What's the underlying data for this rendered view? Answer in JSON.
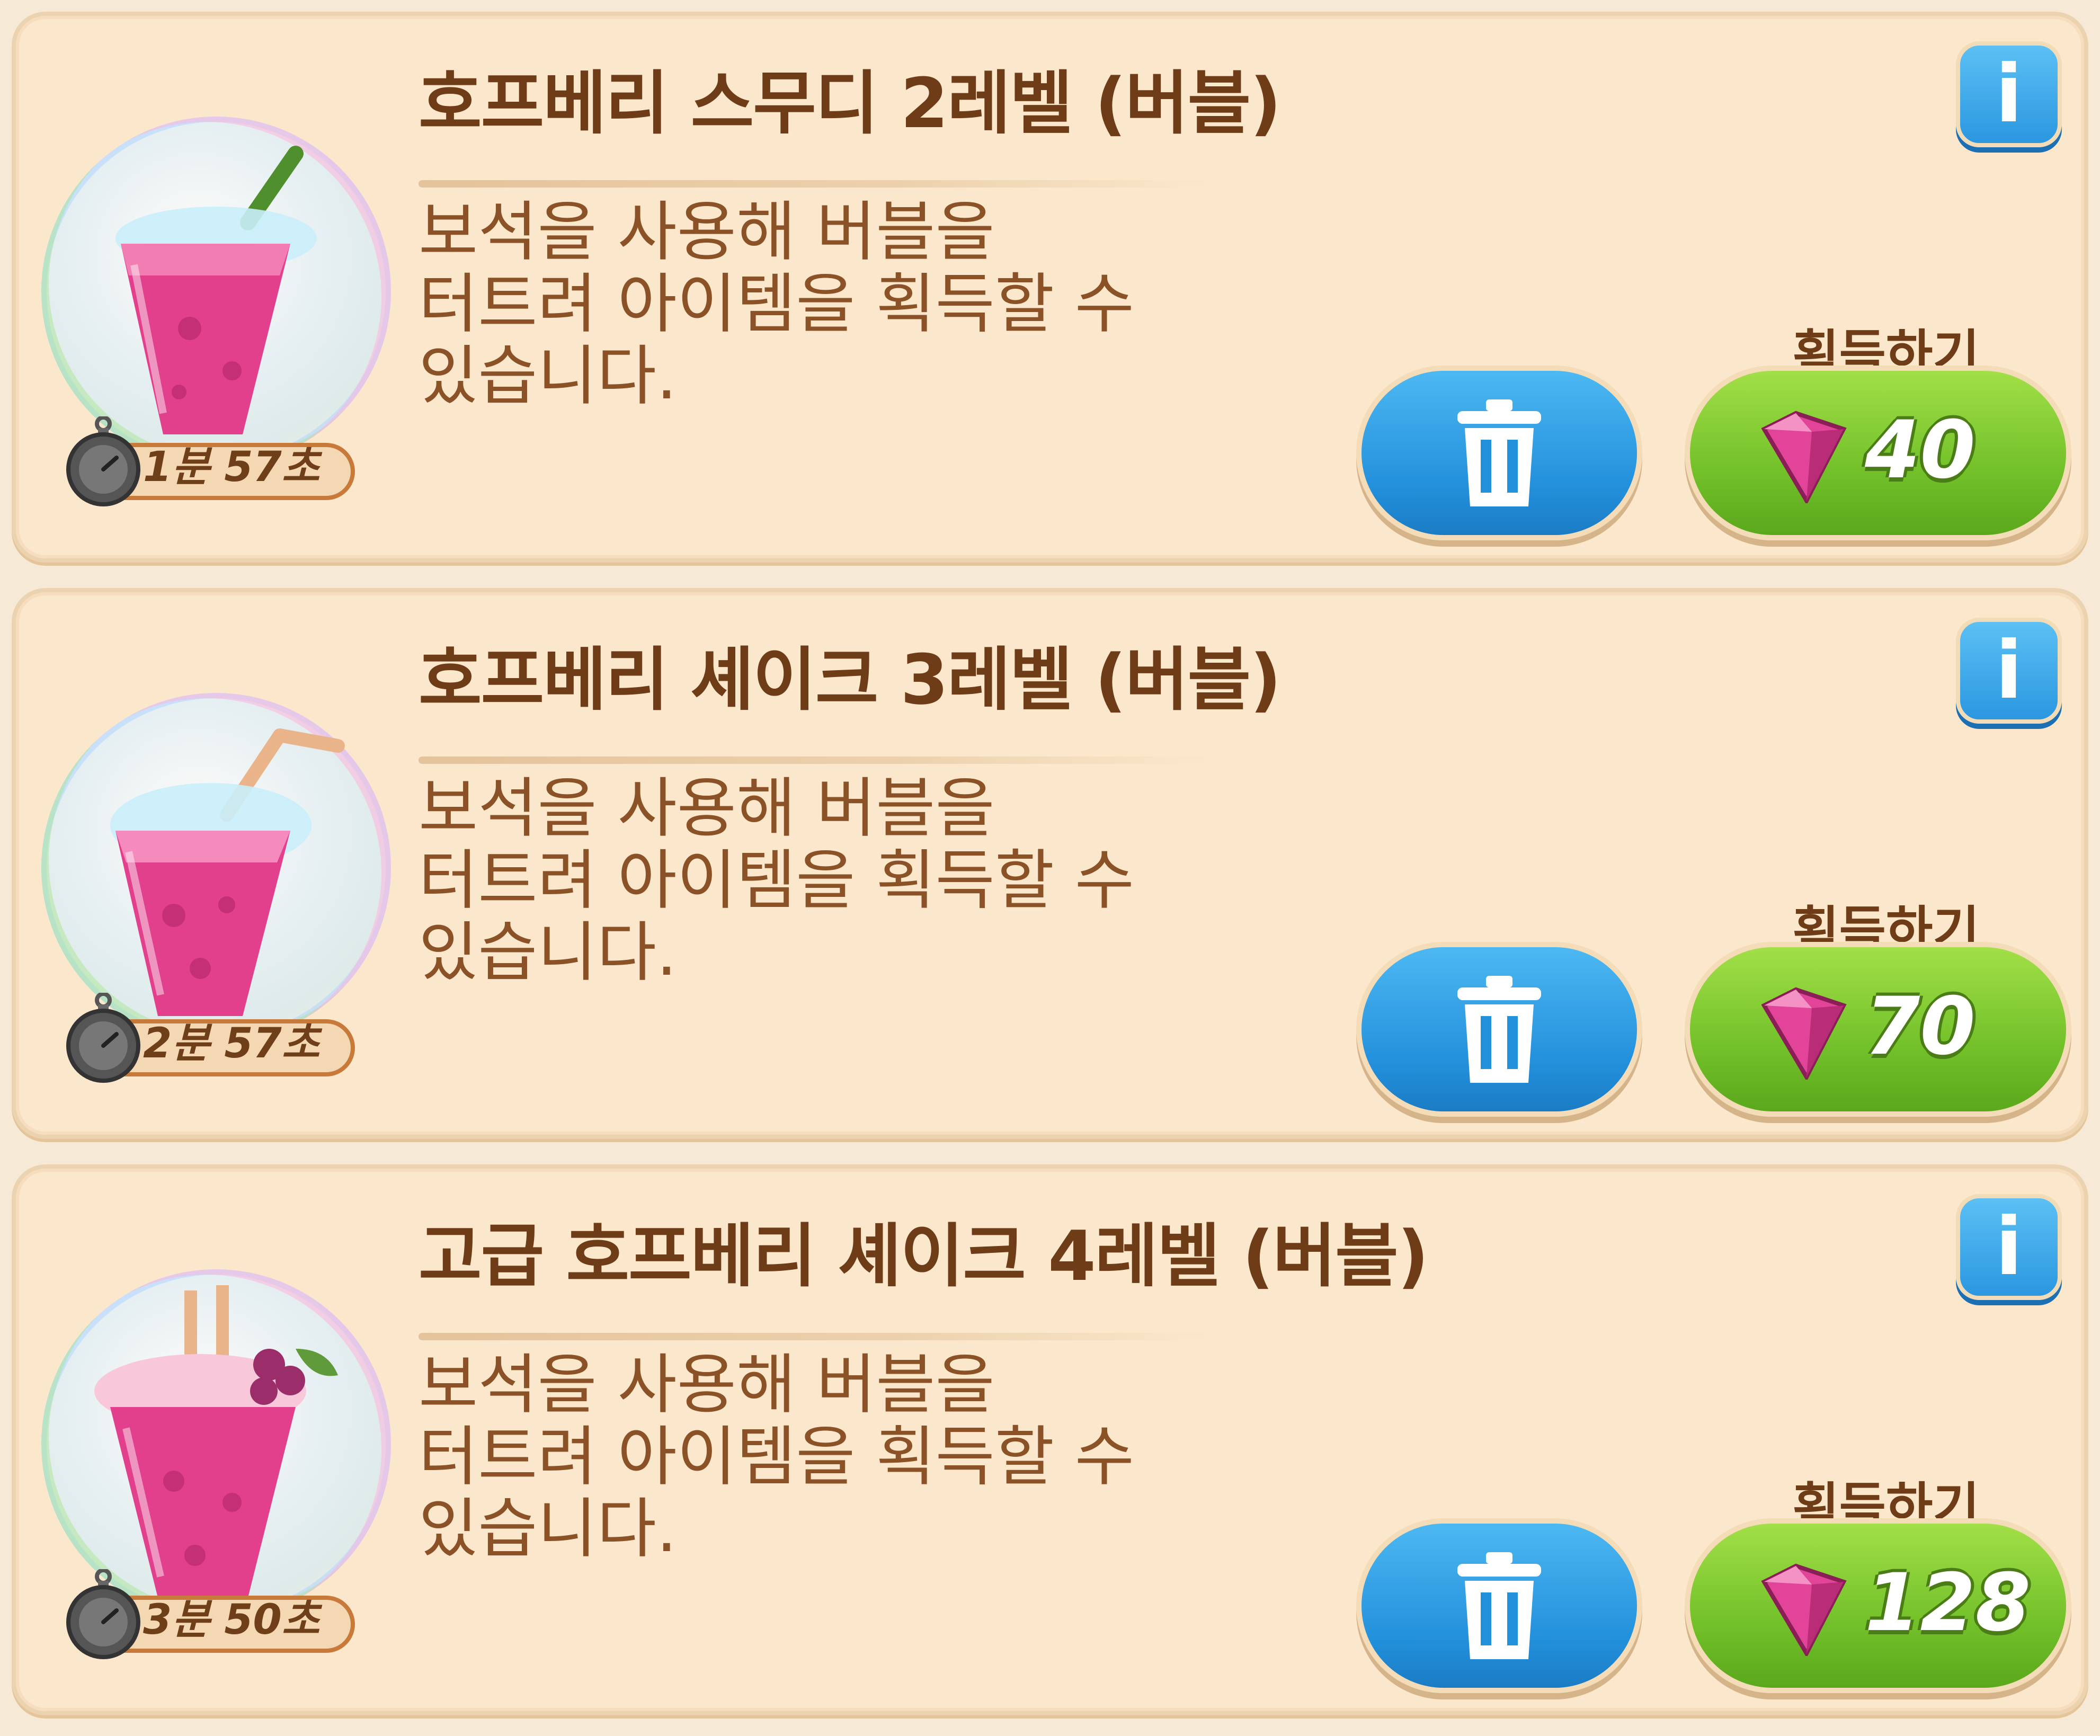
{
  "items": [
    {
      "title": "호프베리 스무디 2레벨 (버블)",
      "description": "보석을 사용해 버블을\n터트려 아이템을 획득할 수\n있습니다.",
      "timer": "1분 57초",
      "obtain_label": "획득하기",
      "price": "40",
      "info_icon": "i",
      "image": "smoothie-cup-icon"
    },
    {
      "title": "호프베리 셰이크 3레벨 (버블)",
      "description": "보석을 사용해 버블을\n터트려 아이템을 획득할 수\n있습니다.",
      "timer": "2분 57초",
      "obtain_label": "획득하기",
      "price": "70",
      "info_icon": "i",
      "image": "shake-cup-icon"
    },
    {
      "title": "고급 호프베리 셰이크 4레벨 (버블)",
      "description": "보석을 사용해 버블을\n터트려 아이템을 획득할 수\n있습니다.",
      "timer": "3분 50초",
      "obtain_label": "획득하기",
      "price": "128",
      "info_icon": "i",
      "image": "premium-shake-cup-icon"
    }
  ],
  "colors": {
    "card_bg": "#fbe8cc",
    "title_text": "#6e3c16",
    "desc_text": "#8a5226",
    "delete_button": "#2390dc",
    "buy_button": "#73c12a",
    "gem": "#e2449a"
  }
}
